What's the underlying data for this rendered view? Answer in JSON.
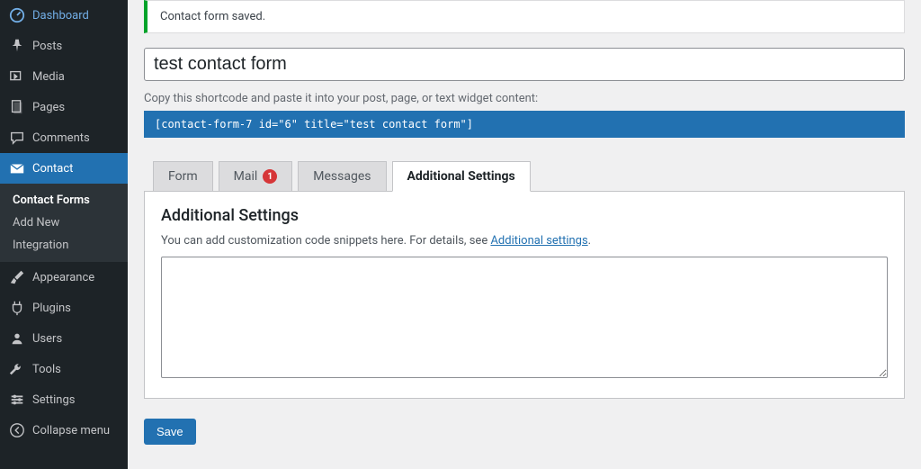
{
  "sidebar": {
    "items": [
      {
        "id": "dashboard",
        "label": "Dashboard",
        "icon": "dashboard"
      },
      {
        "id": "posts",
        "label": "Posts",
        "icon": "pin"
      },
      {
        "id": "media",
        "label": "Media",
        "icon": "media"
      },
      {
        "id": "pages",
        "label": "Pages",
        "icon": "pages"
      },
      {
        "id": "comments",
        "label": "Comments",
        "icon": "comments"
      },
      {
        "id": "contact",
        "label": "Contact",
        "icon": "mail",
        "active": true
      },
      {
        "id": "appearance",
        "label": "Appearance",
        "icon": "brush"
      },
      {
        "id": "plugins",
        "label": "Plugins",
        "icon": "plug"
      },
      {
        "id": "users",
        "label": "Users",
        "icon": "user"
      },
      {
        "id": "tools",
        "label": "Tools",
        "icon": "wrench"
      },
      {
        "id": "settings",
        "label": "Settings",
        "icon": "settings"
      },
      {
        "id": "collapse",
        "label": "Collapse menu",
        "icon": "collapse"
      }
    ],
    "submenu": [
      {
        "label": "Contact Forms",
        "selected": true
      },
      {
        "label": "Add New"
      },
      {
        "label": "Integration"
      }
    ]
  },
  "notice": {
    "message": "Contact form saved."
  },
  "form": {
    "title": "test contact form",
    "shortcode_desc": "Copy this shortcode and paste it into your post, page, or text widget content:",
    "shortcode": "[contact-form-7 id=\"6\" title=\"test contact form\"]"
  },
  "tabs": {
    "items": [
      {
        "id": "form",
        "label": "Form"
      },
      {
        "id": "mail",
        "label": "Mail",
        "badge": "1"
      },
      {
        "id": "messages",
        "label": "Messages"
      },
      {
        "id": "additional",
        "label": "Additional Settings",
        "active": true
      }
    ]
  },
  "panel": {
    "heading": "Additional Settings",
    "desc_prefix": "You can add customization code snippets here. For details, see ",
    "desc_link": "Additional settings",
    "desc_suffix": ".",
    "textarea_value": ""
  },
  "actions": {
    "save_label": "Save"
  }
}
